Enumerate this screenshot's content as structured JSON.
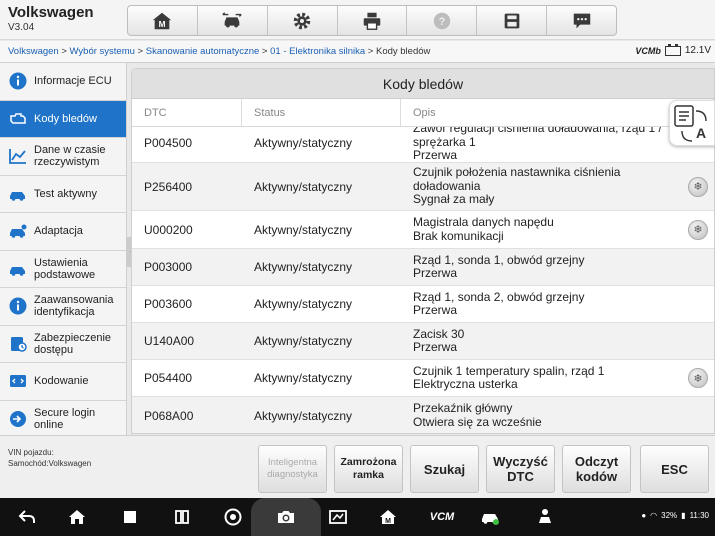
{
  "app": {
    "brand": "Volkswagen",
    "version": "V3.04"
  },
  "toolbar": {
    "icons": [
      "home-icon",
      "vehicle-swap-icon",
      "settings-gear-icon",
      "printer-icon",
      "help-icon",
      "save-icon",
      "message-icon"
    ]
  },
  "breadcrumb": {
    "items": [
      "Volkswagen",
      "Wybór systemu",
      "Skanowanie automatyczne",
      "01 - Elektronika silnika"
    ],
    "current": "Kody bledów",
    "separator": " > "
  },
  "status": {
    "vcm_logo": "VCMb",
    "voltage": "12.1V"
  },
  "sidebar": {
    "items": [
      {
        "label": "Informacje ECU",
        "icon": "info-icon",
        "active": false
      },
      {
        "label": "Kody bledów",
        "icon": "engine-fault-icon",
        "active": true
      },
      {
        "label": "Dane w czasie rzeczywistym",
        "icon": "live-graph-icon",
        "active": false
      },
      {
        "label": "Test aktywny",
        "icon": "car-test-icon",
        "active": false
      },
      {
        "label": "Adaptacja",
        "icon": "car-adapt-icon",
        "active": false
      },
      {
        "label": "Ustawienia podstawowe",
        "icon": "car-settings-icon",
        "active": false
      },
      {
        "label": "Zaawansowania identyfikacja",
        "icon": "info-icon",
        "active": false
      },
      {
        "label": "Zabezpieczenie dostępu",
        "icon": "security-access-icon",
        "active": false
      },
      {
        "label": "Kodowanie",
        "icon": "coding-icon",
        "active": false
      },
      {
        "label": "Secure login online",
        "icon": "secure-login-icon",
        "active": false
      }
    ]
  },
  "main": {
    "title": "Kody bledów",
    "columns": [
      "DTC",
      "Status",
      "Opis"
    ],
    "rows": [
      {
        "dtc": "P004500",
        "status": "Aktywny/statyczny",
        "desc": [
          "Zawór regulacji ciśnienia doładowania, rząd 1 / sprężarka 1",
          "Przerwa"
        ],
        "freeze": false
      },
      {
        "dtc": "P256400",
        "status": "Aktywny/statyczny",
        "desc": [
          "Czujnik położenia nastawnika ciśnienia doładowania",
          "Sygnał za mały"
        ],
        "freeze": true
      },
      {
        "dtc": "U000200",
        "status": "Aktywny/statyczny",
        "desc": [
          "Magistrala danych napędu",
          "Brak komunikacji"
        ],
        "freeze": true
      },
      {
        "dtc": "P003000",
        "status": "Aktywny/statyczny",
        "desc": [
          "Rząd 1, sonda 1, obwód grzejny",
          "Przerwa"
        ],
        "freeze": false
      },
      {
        "dtc": "P003600",
        "status": "Aktywny/statyczny",
        "desc": [
          "Rząd 1, sonda 2, obwód grzejny",
          "Przerwa"
        ],
        "freeze": false
      },
      {
        "dtc": "U140A00",
        "status": "Aktywny/statyczny",
        "desc": [
          "Zacisk 30",
          "Przerwa"
        ],
        "freeze": false
      },
      {
        "dtc": "P054400",
        "status": "Aktywny/statyczny",
        "desc": [
          "Czujnik 1 temperatury spalin, rząd 1",
          "Elektryczna usterka"
        ],
        "freeze": true
      },
      {
        "dtc": "P068A00",
        "status": "Aktywny/statyczny",
        "desc": [
          "Przekaźnik główny",
          "Otwiera się za wcześnie"
        ],
        "freeze": false
      }
    ]
  },
  "footer": {
    "vin_label": "VIN pojazdu:",
    "vehicle_label": "Samochód:Volkswagen",
    "buttons": {
      "smart": "Inteligentna diagnostyka",
      "freeze": "Zamrożona ramka",
      "search": "Szukaj",
      "clear": "Wyczyść DTC",
      "read": "Odczyt kodów",
      "esc": "ESC"
    }
  },
  "navbar": {
    "battery": "32%",
    "time": "11:30",
    "vcm_label": "VCM"
  },
  "colors": {
    "accent": "#1f74c9",
    "header_bg": "#f4f4f4",
    "navbar_bg": "#111111"
  }
}
